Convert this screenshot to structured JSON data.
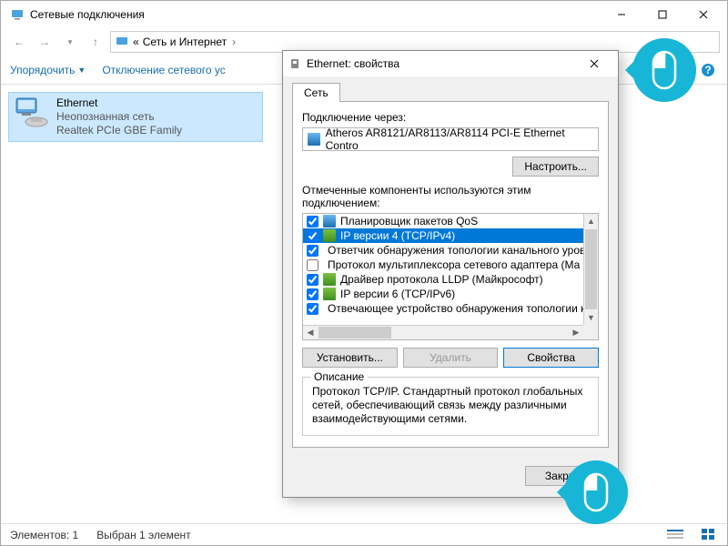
{
  "window": {
    "title": "Сетевые подключения",
    "breadcrumb": {
      "seg1": "Сеть и Интернет",
      "prefix": "«"
    }
  },
  "cmdbar": {
    "organize": "Упорядочить",
    "disable": "Отключение сетевого ус"
  },
  "connection": {
    "name": "Ethernet",
    "status": "Неопознанная сеть",
    "adapter": "Realtek PCIe GBE Family"
  },
  "statusbar": {
    "count": "Элементов: 1",
    "selected": "Выбран 1 элемент"
  },
  "dialog": {
    "title": "Ethernet: свойства",
    "tab": "Сеть",
    "connect_via": "Подключение через:",
    "adapter": "Atheros AR8121/AR8113/AR8114 PCI-E Ethernet Contro",
    "configure": "Настроить...",
    "components_label": "Отмеченные компоненты используются этим подключением:",
    "install": "Установить...",
    "uninstall": "Удалить",
    "properties": "Свойства",
    "desc_legend": "Описание",
    "desc_text": "Протокол TCP/IP. Стандартный протокол глобальных сетей, обеспечивающий связь между различными взаимодействующими сетями.",
    "close": "Закрыть"
  },
  "components": [
    {
      "checked": true,
      "icon": "blue",
      "label": "Планировщик пакетов QoS",
      "selected": false
    },
    {
      "checked": true,
      "icon": "green",
      "label": "IP версии 4 (TCP/IPv4)",
      "selected": true
    },
    {
      "checked": true,
      "icon": "green",
      "label": "Ответчик обнаружения топологии канального уров",
      "selected": false
    },
    {
      "checked": false,
      "icon": "green",
      "label": "Протокол мультиплексора сетевого адаптера (Ма",
      "selected": false
    },
    {
      "checked": true,
      "icon": "green",
      "label": "Драйвер протокола LLDP (Майкрософт)",
      "selected": false
    },
    {
      "checked": true,
      "icon": "green",
      "label": "IP версии 6 (TCP/IPv6)",
      "selected": false
    },
    {
      "checked": true,
      "icon": "green",
      "label": "Отвечающее устройство обнаружения топологии к",
      "selected": false
    }
  ]
}
